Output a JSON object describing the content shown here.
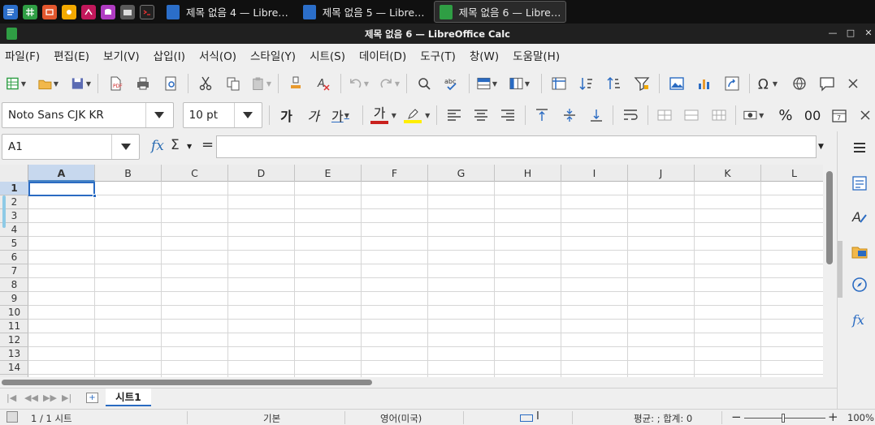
{
  "taskbar": {
    "launchers": [
      {
        "name": "writer-launcher-icon",
        "color": "#2b6ec9"
      },
      {
        "name": "calc-launcher-icon",
        "color": "#2f9e44"
      },
      {
        "name": "impress-launcher-icon",
        "color": "#e4572e"
      },
      {
        "name": "draw-launcher-icon",
        "color": "#f2a900"
      },
      {
        "name": "math-launcher-icon",
        "color": "#c2185b"
      },
      {
        "name": "base-launcher-icon",
        "color": "#b03cc2"
      },
      {
        "name": "screenshot-launcher-icon",
        "color": "#9aa0a6"
      },
      {
        "name": "terminal-launcher-icon",
        "color": "#3a3a3a"
      }
    ],
    "windows": [
      {
        "label": "제목 없음 4 — Libre…",
        "active": false
      },
      {
        "label": "제목 없음 5 — Libre…",
        "active": false
      },
      {
        "label": "제목 없음 6 — Libre…",
        "active": true
      }
    ]
  },
  "window": {
    "title": "제목 없음 6 — LibreOffice Calc"
  },
  "menu": [
    "파일(F)",
    "편집(E)",
    "보기(V)",
    "삽입(I)",
    "서식(O)",
    "스타일(Y)",
    "시트(S)",
    "데이터(D)",
    "도구(T)",
    "창(W)",
    "도움말(H)"
  ],
  "formatting": {
    "font_name": "Noto Sans CJK KR",
    "font_size": "10 pt",
    "bold_label": "가",
    "italic_label": "가",
    "underline_label": "가",
    "font_color_label": "가",
    "percent_label": "%",
    "number_label": "00"
  },
  "formula_bar": {
    "name_box": "A1",
    "fx": "fx",
    "sigma": "Σ",
    "equals": "=",
    "content": ""
  },
  "grid": {
    "columns": [
      "A",
      "B",
      "C",
      "D",
      "E",
      "F",
      "G",
      "H",
      "I",
      "J",
      "K",
      "L"
    ],
    "rows": [
      "1",
      "2",
      "3",
      "4",
      "5",
      "6",
      "7",
      "8",
      "9",
      "10",
      "11",
      "12",
      "13",
      "14"
    ],
    "active_cell": "A1"
  },
  "sheets": {
    "tabs": [
      "시트1"
    ],
    "active": "시트1"
  },
  "status": {
    "sheet_pos": "1 / 1 시트",
    "page_style": "기본",
    "language": "영어(미국)",
    "summary": "평균: ; 합계: 0",
    "zoom": "100%",
    "zoom_minus": "−",
    "zoom_plus": "+"
  },
  "colors": {
    "accent": "#2a6bc2",
    "header_active": "#c7d8ee",
    "calc_green": "#2f9e44"
  }
}
